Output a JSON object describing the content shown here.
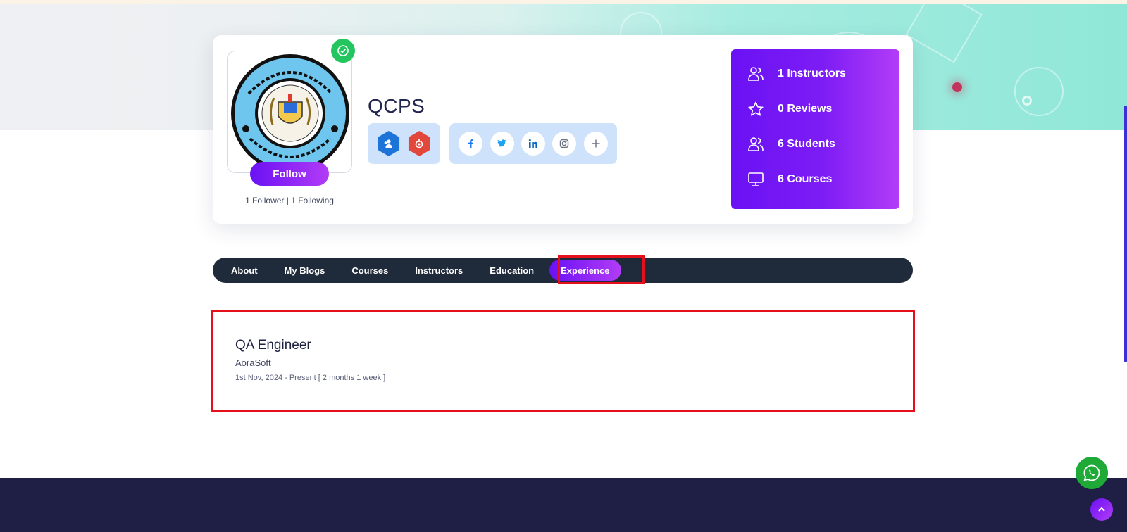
{
  "profile": {
    "name": "QCPS",
    "follow_label": "Follow",
    "follow_stats": "1 Follower | 1 Following",
    "verified": true
  },
  "badges": [
    {
      "icon": "users-badge-icon",
      "color": "#1d74d8"
    },
    {
      "icon": "fire-badge-icon",
      "color": "#e1473b"
    }
  ],
  "social_links": [
    {
      "icon": "facebook-icon",
      "glyph": "f",
      "color": "#1877f2"
    },
    {
      "icon": "twitter-icon",
      "glyph": "t",
      "color": "#1da1f2"
    },
    {
      "icon": "linkedin-icon",
      "glyph": "in",
      "color": "#0a66c2"
    },
    {
      "icon": "instagram-icon",
      "glyph": "ig",
      "color": "#6b7280"
    },
    {
      "icon": "plus-icon",
      "glyph": "+",
      "color": "#6b7280"
    }
  ],
  "stats": [
    {
      "icon": "users-icon",
      "label": "1 Instructors"
    },
    {
      "icon": "star-icon",
      "label": "0 Reviews"
    },
    {
      "icon": "users-icon",
      "label": "6 Students"
    },
    {
      "icon": "monitor-icon",
      "label": "6 Courses"
    }
  ],
  "tabs": [
    {
      "label": "About",
      "active": false
    },
    {
      "label": "My Blogs",
      "active": false
    },
    {
      "label": "Courses",
      "active": false
    },
    {
      "label": "Instructors",
      "active": false
    },
    {
      "label": "Education",
      "active": false
    },
    {
      "label": "Experience",
      "active": true
    }
  ],
  "experience": {
    "title": "QA Engineer",
    "company": "AoraSoft",
    "dates": "1st Nov, 2024 - Present [ 2 months 1 week ]"
  },
  "colors": {
    "accent_start": "#6a11f4",
    "accent_end": "#b23cf6",
    "tab_bar": "#1f2a3a",
    "footer": "#1f1f45",
    "highlight": "#e5101b",
    "whatsapp": "#1faa38"
  }
}
